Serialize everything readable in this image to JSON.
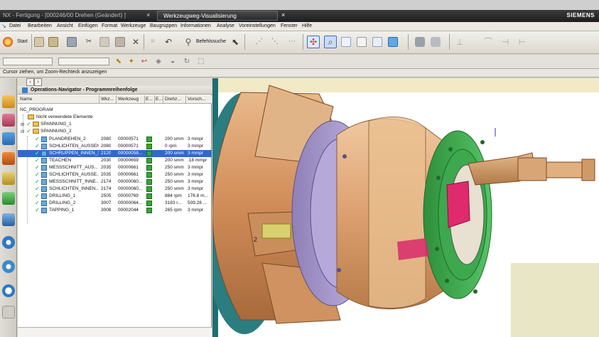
{
  "window": {
    "title_left": "NX - Fertigung - [000246/00 Drehen (Geändert) ]",
    "title_active": "Werkzeugweg-Visualisierung",
    "brand": "SIEMENS"
  },
  "menu": [
    "Datei",
    "Bearbeiten",
    "Ansicht",
    "Einfügen",
    "Format",
    "Werkzeuge",
    "Baugruppen",
    "Informationen",
    "Analyse",
    "Voreinstellungen",
    "Fenster",
    "Hilfe"
  ],
  "toolbar": {
    "start_label": "Start",
    "befehlssuche_label": "Befehlssuche"
  },
  "status_text": "Cursor ziehen, um Zoom-Rechteck anzuzeigen",
  "navigator": {
    "title": "Operations-Navigator - Programmreihenfolge",
    "columns": [
      "Name",
      "Wkz...",
      "Werkzeug",
      "E...",
      "E...",
      "Drehz...",
      "Vorsch..."
    ],
    "root": "NC_PROGRAM",
    "unused": "Nicht verwendete Elemente",
    "groups": [
      "SPANNUNG_1",
      "SPANNUNG_2"
    ],
    "operations": [
      {
        "name": "PLANDREHEN_2",
        "wkz": "2080",
        "tool": "00000571",
        "speed": "200 smm",
        "feed": "3 mmpr"
      },
      {
        "name": "SCHLICHTEN_AUSSEN",
        "wkz": "2080",
        "tool": "00000571",
        "speed": "0 rpm",
        "feed": "3 mmpr"
      },
      {
        "name": "SCHRUPPEN_INNEN_3",
        "wkz": "2120",
        "tool": "00000058...",
        "speed": "200 smm",
        "feed": "3 mmpr",
        "selected": true
      },
      {
        "name": "TEACHEN",
        "wkz": "2030",
        "tool": "00000659",
        "speed": "200 smm",
        "feed": ".18 mmpr"
      },
      {
        "name": "MESSSCHNITT_AUS...",
        "wkz": "2035",
        "tool": "00000661",
        "speed": "250 smm",
        "feed": "3 mmpr"
      },
      {
        "name": "SCHLICHTEN_AUSSE...",
        "wkz": "2035",
        "tool": "00000661",
        "speed": "250 smm",
        "feed": "3 mmpr"
      },
      {
        "name": "MESSSCHNITT_INNE...",
        "wkz": "2174",
        "tool": "00000060...",
        "speed": "250 smm",
        "feed": "3 mmpr"
      },
      {
        "name": "SCHLICHTEN_INNEN...",
        "wkz": "2174",
        "tool": "00000060...",
        "speed": "250 smm",
        "feed": "3 mmpr"
      },
      {
        "name": "DRILLING_1",
        "wkz": "2505",
        "tool": "00000769",
        "speed": "884 rpm",
        "feed": "176.8 m..."
      },
      {
        "name": "DRILLING_2",
        "wkz": "3007",
        "tool": "00000064...",
        "speed": "3183 r...",
        "feed": "509.28 ..."
      },
      {
        "name": "TAPPING_1",
        "wkz": "3008",
        "tool": "00002044",
        "speed": "265 rpm",
        "feed": "3 mmpr"
      }
    ]
  },
  "viewport": {
    "label": "2",
    "colors": {
      "background": "#ffffff",
      "chuck": "#d89a68",
      "ring": "#a79acb",
      "flange": "#38a84a",
      "accent": "#e02a6e"
    }
  }
}
